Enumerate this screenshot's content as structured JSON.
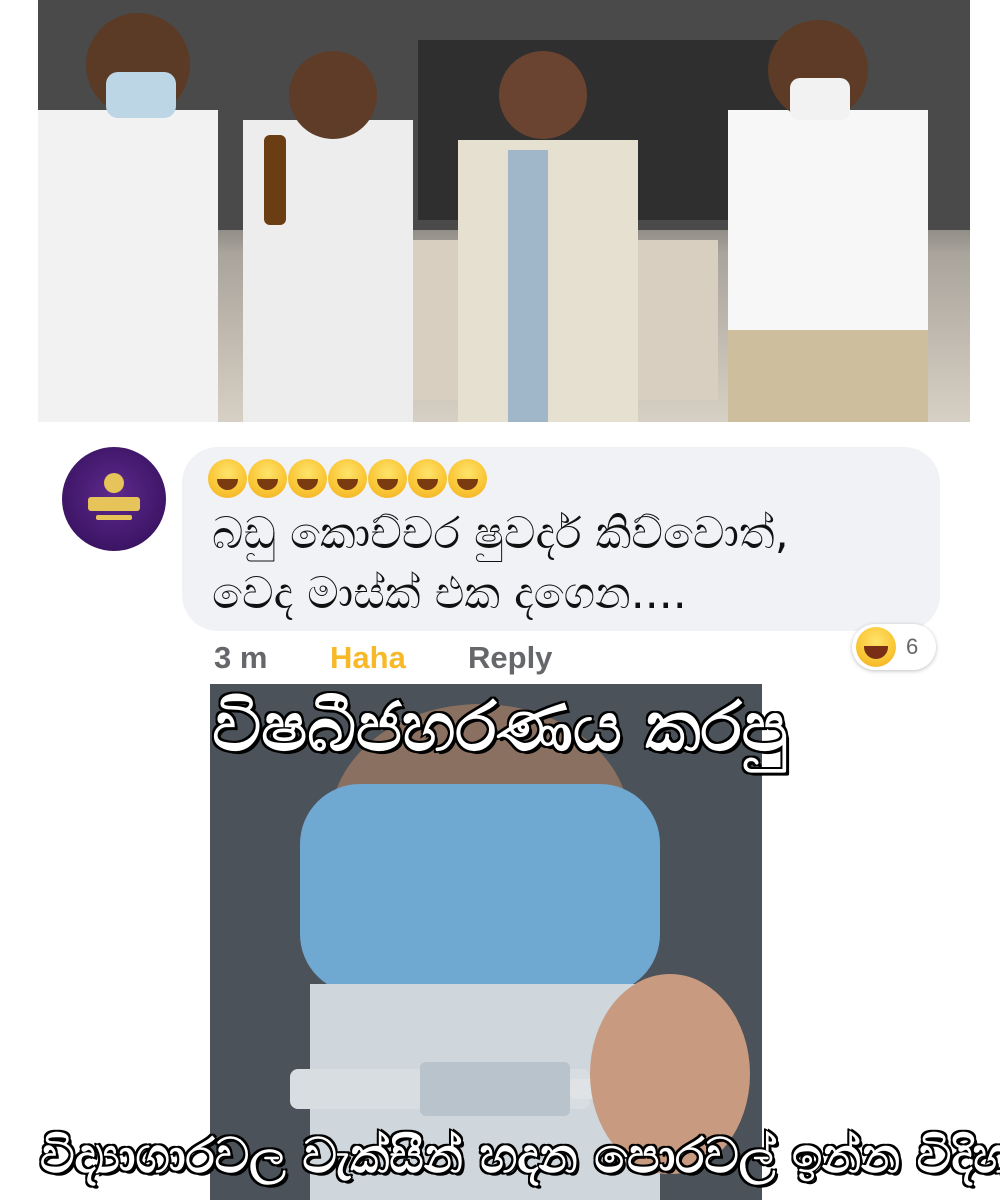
{
  "top_image": {
    "description_icon": "photo-people-in-office"
  },
  "comment": {
    "emojis": [
      "😂",
      "😁",
      "😁",
      "😄",
      "😁",
      "😄",
      "😂"
    ],
    "text_line_1": "බඩු කොච්චර ෂුවර්ද කිව්වොත්,",
    "text_line_2": "වෙද මාස්ක් එක දගෙන....",
    "timestamp": "3 m",
    "reaction_action": "Haha",
    "reply_action": "Reply",
    "reaction_icon": "haha-emoji-icon",
    "reaction_count": "6",
    "avatar_icon": "page-logo-avatar",
    "colors": {
      "bubble": "#f0f2f5",
      "haha": "#f7b928",
      "meta": "#65676b",
      "avatar": "#3d1566"
    }
  },
  "captions": {
    "top": "විෂබීජහරණය කරපු",
    "bottom": "විද්‍යාගාරවල වැක්සීන් හදන පොරවල් ඉන්න විදිහ"
  }
}
